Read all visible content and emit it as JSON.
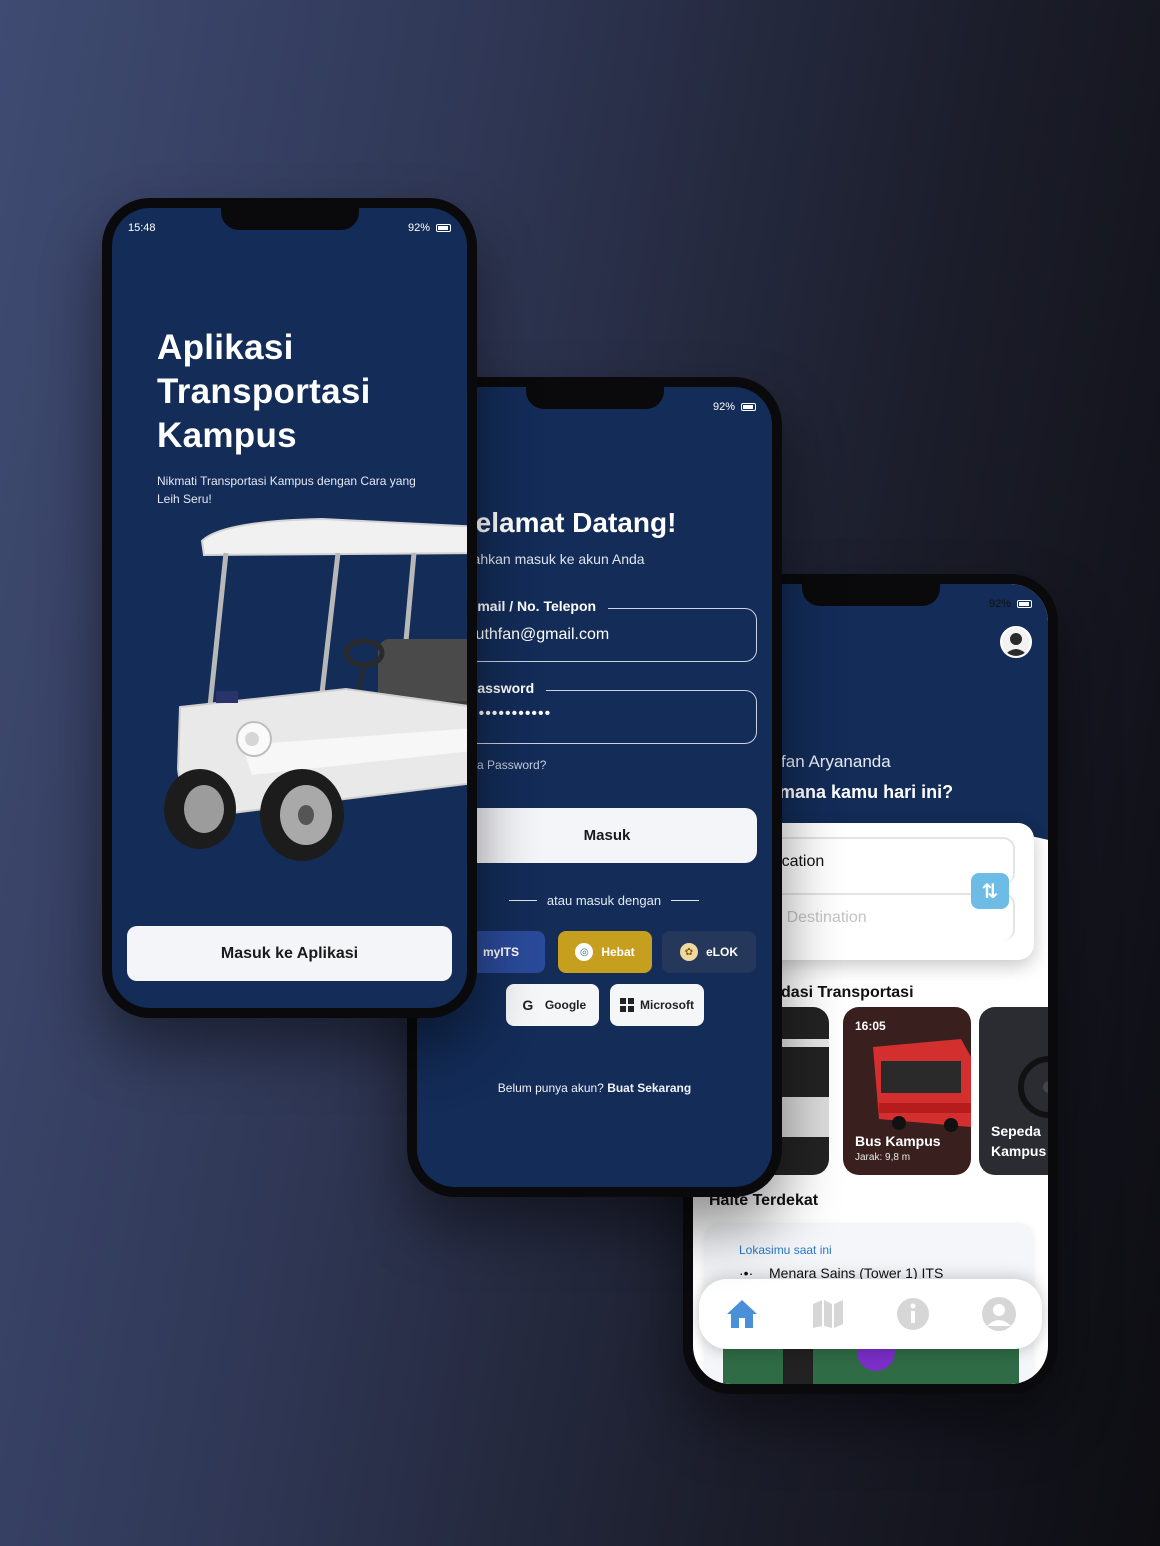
{
  "phone1": {
    "status_time": "15:48",
    "battery": "92%",
    "title_line1": "Aplikasi",
    "title_line2": "Transportasi",
    "title_line3": "Kampus",
    "subtitle": "Nikmati Transportasi Kampus dengan Cara yang Leih Seru!",
    "button_label": "Masuk ke Aplikasi"
  },
  "phone2": {
    "battery": "92%",
    "title": "Selamat Datang!",
    "subtitle": "Silahkan masuk ke akun Anda",
    "email_label": "Email / No. Telepon",
    "email_value": "luthfan@gmail.com",
    "password_label": "Password",
    "password_value": "••••••••••••",
    "forgot_label": "Lupa Password?",
    "login_button": "Masuk",
    "or_label": "atau masuk dengan",
    "sso": {
      "myits": "myITS",
      "hebat": "Hebat",
      "elok": "eLOK",
      "google": "Google",
      "microsoft": "Microsoft"
    },
    "register_text": "Belum punya akun?",
    "register_link": "Buat Sekarang"
  },
  "phone3": {
    "battery": "92%",
    "user_name": "Hai, Luthfan Aryananda",
    "question": "Mau ke mana kamu hari ini?",
    "your_location": "Your Location",
    "choose_destination": "Choose Destination",
    "recommend_title": "Rekomendasi Transportasi",
    "cards": [
      {
        "time": "",
        "name": "",
        "distance": ""
      },
      {
        "time": "16:05",
        "name": "Bus Kampus",
        "distance": "Jarak: 9,8 m"
      },
      {
        "time": "",
        "name": "Sepeda Kampus",
        "distance": ""
      }
    ],
    "halte_title": "Halte Terdekat",
    "halte_label": "Lokasimu saat ini",
    "halte_location": "Menara Sains (Tower 1) ITS",
    "nav": [
      "home-icon",
      "map-icon",
      "info-icon",
      "profile-icon"
    ],
    "colors": {
      "primary": "#132c58",
      "accent": "#6cbce6",
      "nav_active": "#4a90d9",
      "hebat": "#c79f1e",
      "myits": "#2a4a9a"
    }
  }
}
